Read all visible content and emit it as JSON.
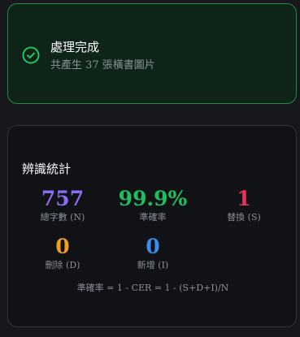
{
  "success": {
    "icon": "check-circle-icon",
    "title": "處理完成",
    "subtitle": "共產生 37 張橫書圖片",
    "accent_color": "#22c55e"
  },
  "stats": {
    "title": "辨識統計",
    "items": [
      {
        "value": "757",
        "label": "總字數 (N)",
        "color": "#8b6cf0"
      },
      {
        "value": "99.9%",
        "label": "準確率",
        "color": "#1fbf5f"
      },
      {
        "value": "1",
        "label": "替換 (S)",
        "color": "#e8335a"
      },
      {
        "value": "0",
        "label": "刪除 (D)",
        "color": "#f0a020"
      },
      {
        "value": "0",
        "label": "新增 (I)",
        "color": "#3b8df0"
      }
    ],
    "formula": "準確率 = 1 - CER = 1 - (S+D+I)/N"
  }
}
